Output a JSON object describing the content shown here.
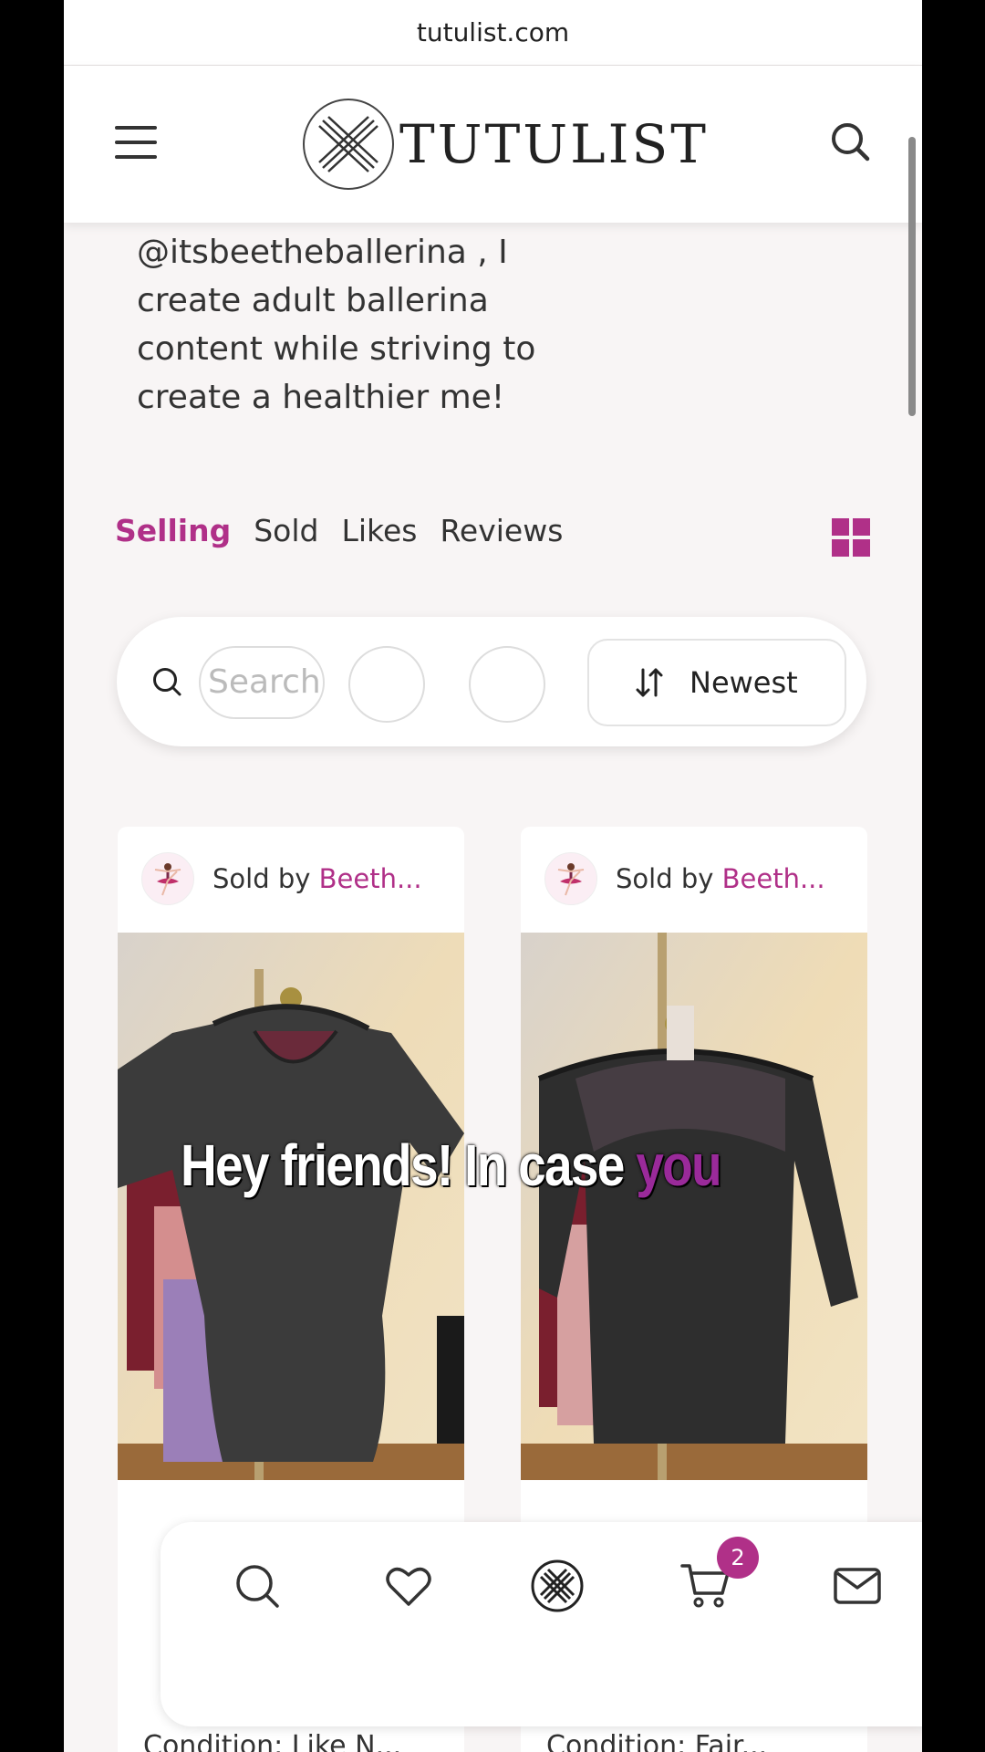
{
  "browser": {
    "url": "tutulist.com"
  },
  "header": {
    "logo_text": "TUTULIST"
  },
  "profile": {
    "bio": "@itsbeetheballerina , I create adult ballerina content while striving to create a healthier me!"
  },
  "tabs": [
    {
      "label": "Selling",
      "active": true
    },
    {
      "label": "Sold",
      "active": false
    },
    {
      "label": "Likes",
      "active": false
    },
    {
      "label": "Reviews",
      "active": false
    }
  ],
  "filters": {
    "search_placeholder": "Search",
    "sort_label": "Newest"
  },
  "listings": [
    {
      "sold_by_prefix": "Sold by ",
      "seller": "Beeth...",
      "condition": "Condition: Like N..."
    },
    {
      "sold_by_prefix": "Sold by ",
      "seller": "Beeth...",
      "condition": "Condition: Fair..."
    }
  ],
  "caption": {
    "text": "Hey friends! In case ",
    "highlight": "you"
  },
  "bottom_nav": {
    "items": [
      "search-icon",
      "heart-icon",
      "tutulist-logo-icon",
      "cart-icon",
      "mail-icon"
    ],
    "cart_count": "2"
  },
  "colors": {
    "accent": "#b03088",
    "background": "#f8f5f5"
  }
}
